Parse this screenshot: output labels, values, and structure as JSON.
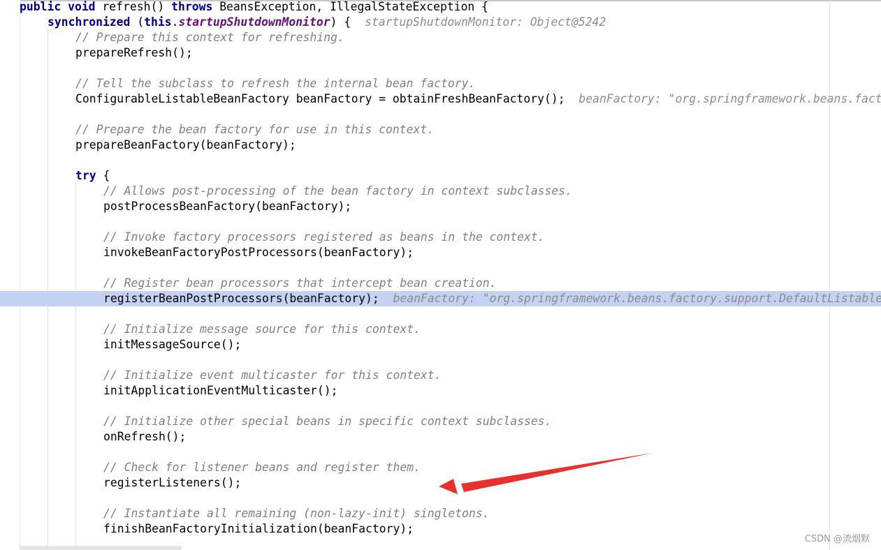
{
  "editor": {
    "lines": [
      {
        "indent": 0,
        "tokens": [
          {
            "t": "kw",
            "v": "public "
          },
          {
            "t": "kw",
            "v": "void "
          },
          {
            "t": "p",
            "v": "refresh() "
          },
          {
            "t": "kw",
            "v": "throws "
          },
          {
            "t": "p",
            "v": "BeansException, IllegalStateException {"
          }
        ]
      },
      {
        "indent": 1,
        "tokens": [
          {
            "t": "kw",
            "v": "synchronized "
          },
          {
            "t": "p",
            "v": "("
          },
          {
            "t": "kw",
            "v": "this"
          },
          {
            "t": "p",
            "v": "."
          },
          {
            "t": "fld",
            "v": "startupShutdownMonitor"
          },
          {
            "t": "p",
            "v": ") {  "
          },
          {
            "t": "hint",
            "v": "startupShutdownMonitor: Object@5242"
          }
        ]
      },
      {
        "indent": 2,
        "tokens": [
          {
            "t": "cmt",
            "v": "// Prepare this context for refreshing."
          }
        ]
      },
      {
        "indent": 2,
        "tokens": [
          {
            "t": "p",
            "v": "prepareRefresh();"
          }
        ]
      },
      {
        "indent": 0,
        "tokens": []
      },
      {
        "indent": 2,
        "tokens": [
          {
            "t": "cmt",
            "v": "// Tell the subclass to refresh the internal bean factory."
          }
        ]
      },
      {
        "indent": 2,
        "tokens": [
          {
            "t": "p",
            "v": "ConfigurableListableBeanFactory beanFactory = obtainFreshBeanFactory();  "
          },
          {
            "t": "hint",
            "v": "beanFactory: \"org.springframework.beans.factory.support.DefaultListableBeanFactory"
          }
        ]
      },
      {
        "indent": 0,
        "tokens": []
      },
      {
        "indent": 2,
        "tokens": [
          {
            "t": "cmt",
            "v": "// Prepare the bean factory for use in this context."
          }
        ]
      },
      {
        "indent": 2,
        "tokens": [
          {
            "t": "p",
            "v": "prepareBeanFactory(beanFactory);"
          }
        ]
      },
      {
        "indent": 0,
        "tokens": []
      },
      {
        "indent": 2,
        "tokens": [
          {
            "t": "kw",
            "v": "try "
          },
          {
            "t": "p",
            "v": "{"
          }
        ]
      },
      {
        "indent": 3,
        "tokens": [
          {
            "t": "cmt",
            "v": "// Allows post-processing of the bean factory in context subclasses."
          }
        ]
      },
      {
        "indent": 3,
        "tokens": [
          {
            "t": "p",
            "v": "postProcessBeanFactory(beanFactory);"
          }
        ]
      },
      {
        "indent": 0,
        "tokens": []
      },
      {
        "indent": 3,
        "tokens": [
          {
            "t": "cmt",
            "v": "// Invoke factory processors registered as beans in the context."
          }
        ]
      },
      {
        "indent": 3,
        "tokens": [
          {
            "t": "p",
            "v": "invokeBeanFactoryPostProcessors(beanFactory);"
          }
        ]
      },
      {
        "indent": 0,
        "tokens": []
      },
      {
        "indent": 3,
        "tokens": [
          {
            "t": "cmt",
            "v": "// Register bean processors that intercept bean creation."
          }
        ]
      },
      {
        "indent": 3,
        "current": true,
        "tokens": [
          {
            "t": "p",
            "v": "registerBeanPostProcessors(beanFactory);  "
          },
          {
            "t": "hint",
            "v": "beanFactory: \"org.springframework.beans.factory.support.DefaultListableBeanFactory"
          }
        ]
      },
      {
        "indent": 0,
        "tokens": []
      },
      {
        "indent": 3,
        "tokens": [
          {
            "t": "cmt",
            "v": "// Initialize message source for this context."
          }
        ]
      },
      {
        "indent": 3,
        "tokens": [
          {
            "t": "p",
            "v": "initMessageSource();"
          }
        ]
      },
      {
        "indent": 0,
        "tokens": []
      },
      {
        "indent": 3,
        "tokens": [
          {
            "t": "cmt",
            "v": "// Initialize event multicaster for this context."
          }
        ]
      },
      {
        "indent": 3,
        "tokens": [
          {
            "t": "p",
            "v": "initApplicationEventMulticaster();"
          }
        ]
      },
      {
        "indent": 0,
        "tokens": []
      },
      {
        "indent": 3,
        "tokens": [
          {
            "t": "cmt",
            "v": "// Initialize other special beans in specific context subclasses."
          }
        ]
      },
      {
        "indent": 3,
        "tokens": [
          {
            "t": "p",
            "v": "onRefresh();"
          }
        ]
      },
      {
        "indent": 0,
        "tokens": []
      },
      {
        "indent": 3,
        "tokens": [
          {
            "t": "cmt",
            "v": "// Check for listener beans and register them."
          }
        ]
      },
      {
        "indent": 3,
        "tokens": [
          {
            "t": "p",
            "v": "registerListeners();"
          }
        ]
      },
      {
        "indent": 0,
        "tokens": []
      },
      {
        "indent": 3,
        "tokens": [
          {
            "t": "cmt",
            "v": "// Instantiate all remaining (non-lazy-init) singletons."
          }
        ]
      },
      {
        "indent": 3,
        "tokens": [
          {
            "t": "p",
            "v": "finishBeanFactoryInitialization(beanFactory);"
          }
        ]
      }
    ]
  },
  "annotation": {
    "arrow_color": "#e8312d",
    "points_to": "registerListeners();"
  },
  "colors": {
    "keyword": "#000080",
    "field": "#660e7a",
    "comment": "#808080",
    "inline_hint": "#8c8c8c",
    "current_line": "#c3d2f2"
  },
  "watermark": {
    "text": "CSDN @流烟默"
  }
}
